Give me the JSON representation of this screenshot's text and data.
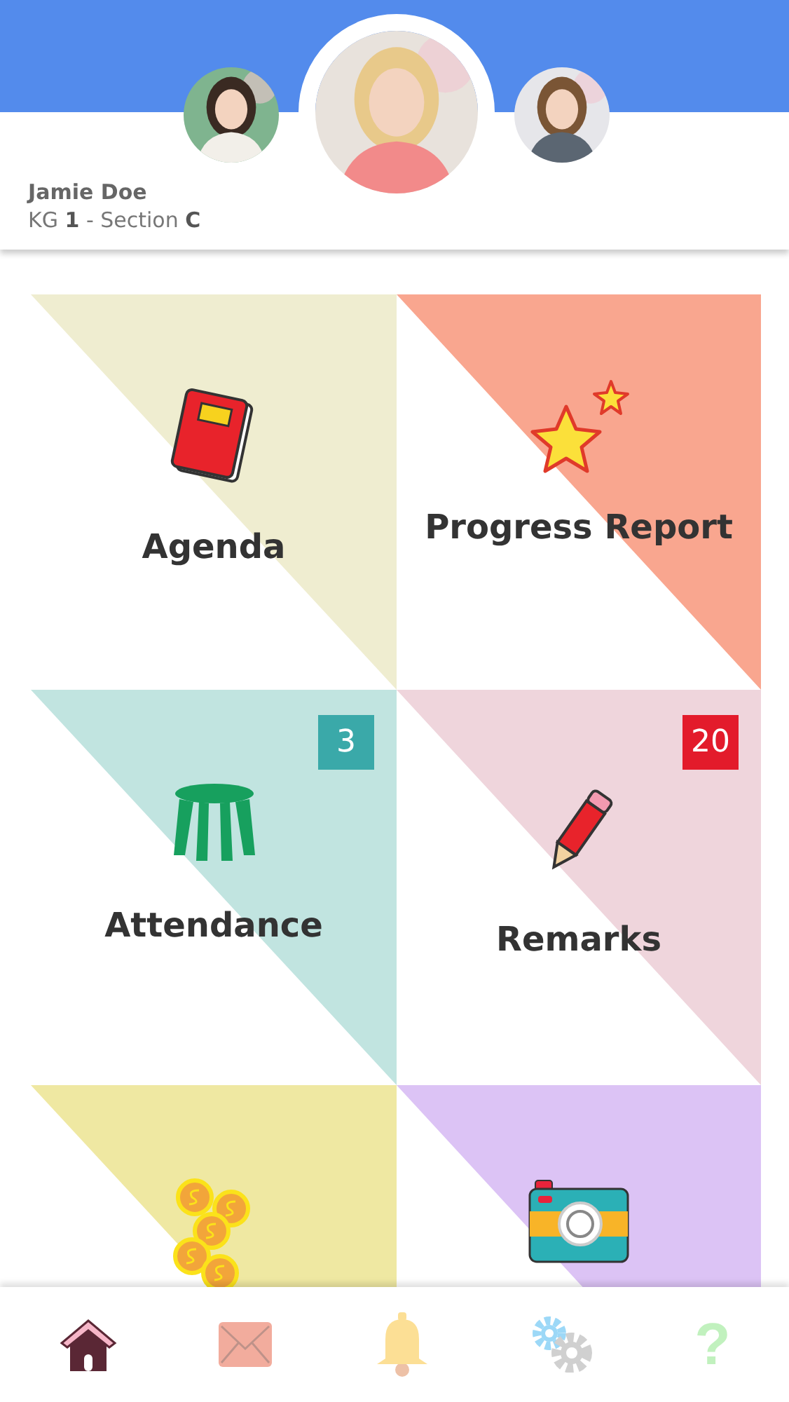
{
  "profile": {
    "avatars": [
      {
        "kind": "picture",
        "selected": false
      },
      {
        "kind": "picture",
        "selected": true
      },
      {
        "kind": "picture",
        "selected": false
      }
    ],
    "name": "Jamie Doe",
    "class_line": "KG **1** - Section **C**"
  },
  "tiles": [
    {
      "label": "Agenda",
      "kind": "notebook",
      "color": "#efedd0"
    },
    {
      "label": "Progress Report",
      "kind": "star",
      "color": "#f9a68f"
    },
    {
      "label": "Attendance",
      "kind": "stool",
      "color": "#c1e4e0",
      "badge": {
        "text": "3",
        "color": "#3aa9a9"
      }
    },
    {
      "label": "Remarks",
      "kind": "pencil",
      "color": "#efd5dc",
      "badge": {
        "text": "20",
        "color": "#e31b2b"
      }
    },
    {
      "kind": "coins",
      "color": "#efe8a2"
    },
    {
      "kind": "camera",
      "color": "#dcc3f5"
    }
  ],
  "nav": [
    {
      "kind": "home",
      "selected": true
    },
    {
      "kind": "mail",
      "selected": false
    },
    {
      "kind": "bell",
      "selected": false
    },
    {
      "kind": "gears",
      "selected": false
    },
    {
      "kind": "help",
      "glyph": "?",
      "selected": false
    }
  ]
}
